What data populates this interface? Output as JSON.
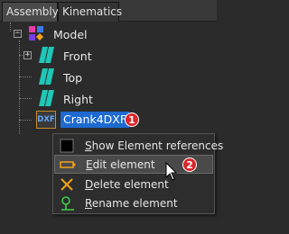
{
  "tabs": [
    {
      "label": "Assembly",
      "active": true
    },
    {
      "label": "Kinematics",
      "active": false
    }
  ],
  "tree": {
    "root": {
      "label": "Model",
      "icon": "model-icon",
      "expander": "−"
    },
    "planes": [
      {
        "label": "Front",
        "icon": "plane-icon",
        "expander": "+"
      },
      {
        "label": "Top",
        "icon": "plane-icon"
      },
      {
        "label": "Right",
        "icon": "plane-icon"
      }
    ],
    "element": {
      "label": "Crank4DXF",
      "icon_text": "DXF",
      "icon": "dxf-icon",
      "badge": "1"
    }
  },
  "context_menu": {
    "items": [
      {
        "mnemonic": "S",
        "rest": "how Element references",
        "icon": "references-icon"
      },
      {
        "mnemonic": "E",
        "rest": "dit element",
        "icon": "edit-icon",
        "badge": "2",
        "hovered": true
      },
      {
        "mnemonic": "D",
        "rest": "elete element",
        "icon": "delete-icon"
      },
      {
        "mnemonic": "R",
        "rest": "ename element",
        "icon": "rename-icon"
      }
    ]
  },
  "colors": {
    "selection": "#1e6ad0",
    "badge": "#d9262a",
    "plane": "#1fc7b8",
    "dxf_border": "#c88a2a",
    "dxf_text": "#5fa8ff"
  }
}
